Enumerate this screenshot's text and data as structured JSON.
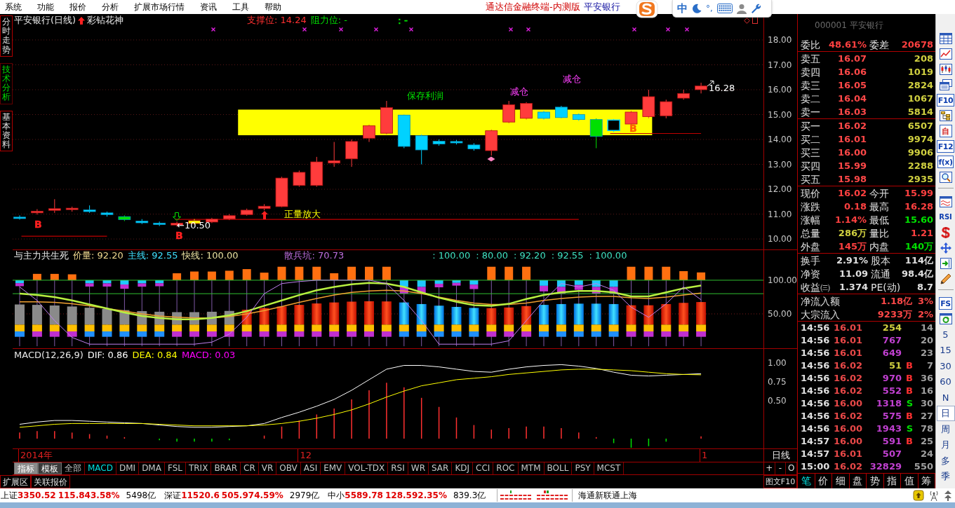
{
  "menu_bar": {
    "items": [
      "系统",
      "功能",
      "报价",
      "分析",
      "扩展市场行情",
      "资讯",
      "工具",
      "帮助"
    ],
    "app_title": "通达信金融终端-内测版",
    "stock_name": "平安银行"
  },
  "ime_bar": {
    "mode": "中",
    "punctuation": "°,"
  },
  "side_tabs": [
    {
      "label": "分时走势",
      "selected": false
    },
    {
      "label": "技术分析",
      "selected": true
    },
    {
      "label": "基本资料",
      "selected": false
    }
  ],
  "price_panel": {
    "title": "平安银行(日线)",
    "formula": "彩钻花神",
    "outputs": [
      {
        "text": "支撑位: 14.24",
        "color": "#ff3030"
      },
      {
        "text": "阻力位: -",
        "color": "#00e000"
      },
      {
        "text": ": -",
        "color": "#00e000"
      }
    ],
    "annotations": [
      {
        "text": "保存利润",
        "color": "#00e000"
      },
      {
        "text": "减仓",
        "color": "#ff40ff"
      },
      {
        "text": "减仓",
        "color": "#ff40ff"
      },
      {
        "text": "正量放大",
        "color": "#ffff00"
      },
      {
        "text": "16.28",
        "color": "#ffffff"
      },
      {
        "text": "←10.50",
        "color": "#ffffff"
      },
      {
        "text": "B",
        "color": "#ff2020"
      },
      {
        "text": "B",
        "color": "#ff2020"
      },
      {
        "text": "B",
        "color": "#ff6000"
      }
    ],
    "axis_labels": [
      "18.00",
      "17.00",
      "16.00",
      "15.00",
      "14.00",
      "13.00",
      "12.00",
      "11.00",
      "10.00"
    ]
  },
  "indicator_panel": {
    "title": "与主力共生死",
    "readings": [
      {
        "text": "价量: 92.20",
        "color": "#f0d890"
      },
      {
        "text": "主线: 92.55",
        "color": "#40e0ff"
      },
      {
        "text": "快线: 100.00",
        "color": "#e8e0a0"
      },
      {
        "text": "散兵坑: 70.73",
        "color": "#c070e0"
      }
    ],
    "extra_readings": [
      {
        "text": ": 100.00",
        "color": "#40e0c0"
      },
      {
        "text": ": 80.00",
        "color": "#40e0c0"
      },
      {
        "text": ": 92.20",
        "color": "#40e0c0"
      },
      {
        "text": ": 92.55",
        "color": "#40e0c0"
      },
      {
        "text": ": 100.00",
        "color": "#40e0c0"
      }
    ],
    "axis_labels": [
      "100.00",
      "50.00"
    ]
  },
  "macd_panel": {
    "title": "MACD(12,26,9)",
    "readings": [
      {
        "text": "DIF: 0.86",
        "color": "#ffffff"
      },
      {
        "text": "DEA: 0.84",
        "color": "#ffff00"
      },
      {
        "text": "MACD: 0.03",
        "color": "#ff00ff"
      }
    ],
    "axis_labels": [
      "1.00",
      "0.75",
      "0.50"
    ]
  },
  "date_labels": [
    "2014年",
    "12",
    "1"
  ],
  "period_label": "日线",
  "indicator_tabs": [
    {
      "label": "指标",
      "kind": "button",
      "selected": true
    },
    {
      "label": "模板",
      "kind": "button",
      "selected": false
    },
    {
      "label": "全部",
      "kind": "tab",
      "selected": false
    },
    {
      "label": "MACD",
      "kind": "tab",
      "selected": true
    },
    {
      "label": "DMI",
      "kind": "tab",
      "selected": false
    },
    {
      "label": "DMA",
      "kind": "tab",
      "selected": false
    },
    {
      "label": "FSL",
      "kind": "tab",
      "selected": false
    },
    {
      "label": "TRIX",
      "kind": "tab",
      "selected": false
    },
    {
      "label": "BRAR",
      "kind": "tab",
      "selected": false
    },
    {
      "label": "CR",
      "kind": "tab",
      "selected": false
    },
    {
      "label": "VR",
      "kind": "tab",
      "selected": false
    },
    {
      "label": "OBV",
      "kind": "tab",
      "selected": false
    },
    {
      "label": "ASI",
      "kind": "tab",
      "selected": false
    },
    {
      "label": "EMV",
      "kind": "tab",
      "selected": false
    },
    {
      "label": "VOL-TDX",
      "kind": "tab",
      "selected": false
    },
    {
      "label": "RSI",
      "kind": "tab",
      "selected": false
    },
    {
      "label": "WR",
      "kind": "tab",
      "selected": false
    },
    {
      "label": "SAR",
      "kind": "tab",
      "selected": false
    },
    {
      "label": "KDJ",
      "kind": "tab",
      "selected": false
    },
    {
      "label": "CCI",
      "kind": "tab",
      "selected": false
    },
    {
      "label": "ROC",
      "kind": "tab",
      "selected": false
    },
    {
      "label": "MTM",
      "kind": "tab",
      "selected": false
    },
    {
      "label": "BOLL",
      "kind": "tab",
      "selected": false
    },
    {
      "label": "PSY",
      "kind": "tab",
      "selected": false
    },
    {
      "label": "MCST",
      "kind": "tab",
      "selected": false
    }
  ],
  "chart_buttons": [
    "+",
    "-",
    "O"
  ],
  "extension_tabs": [
    "扩展区",
    "关联报价"
  ],
  "f10_button": "图文F10",
  "quote_panel": {
    "title": "000001 平安银行",
    "order_ratio": [
      {
        "label": "委比",
        "value": "48.61%",
        "color": "#ff4040"
      },
      {
        "label": "委差",
        "value": "20678",
        "color": "#ff4040"
      }
    ],
    "asks": [
      {
        "label": "卖五",
        "price": "16.07",
        "volume": "208"
      },
      {
        "label": "卖四",
        "price": "16.06",
        "volume": "1019"
      },
      {
        "label": "卖三",
        "price": "16.05",
        "volume": "2824"
      },
      {
        "label": "卖二",
        "price": "16.04",
        "volume": "1067"
      },
      {
        "label": "卖一",
        "price": "16.03",
        "volume": "5814"
      }
    ],
    "bids": [
      {
        "label": "买一",
        "price": "16.02",
        "volume": "6507"
      },
      {
        "label": "买二",
        "price": "16.01",
        "volume": "9974"
      },
      {
        "label": "买三",
        "price": "16.00",
        "volume": "9906"
      },
      {
        "label": "买四",
        "price": "15.99",
        "volume": "2288"
      },
      {
        "label": "买五",
        "price": "15.98",
        "volume": "2935"
      }
    ],
    "stats": [
      {
        "label": "现价",
        "value": "16.02",
        "color": "#ff4040"
      },
      {
        "label": "今开",
        "value": "15.99",
        "color": "#ff4040"
      },
      {
        "label": "涨跌",
        "value": "0.18",
        "color": "#ff4040"
      },
      {
        "label": "最高",
        "value": "16.28",
        "color": "#ff4040"
      },
      {
        "label": "涨幅",
        "value": "1.14%",
        "color": "#ff4040"
      },
      {
        "label": "最低",
        "value": "15.60",
        "color": "#00e000"
      },
      {
        "label": "总量",
        "value": "286万",
        "color": "#d0d040"
      },
      {
        "label": "量比",
        "value": "1.21",
        "color": "#ff4040"
      },
      {
        "label": "外盘",
        "value": "145万",
        "color": "#ff4040"
      },
      {
        "label": "内盘",
        "value": "140万",
        "color": "#00e000"
      }
    ],
    "fundamentals": [
      {
        "label": "换手",
        "value": "2.91%"
      },
      {
        "label": "股本",
        "value": "114亿"
      },
      {
        "label": "净资",
        "value": "11.09"
      },
      {
        "label": "流通",
        "value": "98.4亿"
      },
      {
        "label": "收益㈢",
        "value": "1.374"
      },
      {
        "label": "PE(动)",
        "value": "8.7"
      }
    ],
    "flows": [
      {
        "label": "净流入额",
        "amount": "1.18亿",
        "share": "3%"
      },
      {
        "label": "大宗流入",
        "amount": "9233万",
        "share": "2%"
      }
    ],
    "ticks": [
      {
        "time": "14:56",
        "price": "16.01",
        "volume": "254",
        "color": "#d0d040",
        "count": "14"
      },
      {
        "time": "14:56",
        "price": "16.01",
        "volume": "767",
        "color": "#c040d0",
        "count": "20"
      },
      {
        "time": "14:56",
        "price": "16.01",
        "volume": "649",
        "color": "#c040d0",
        "count": "23"
      },
      {
        "time": "14:56",
        "price": "16.02",
        "volume": "51",
        "color": "#d0d040",
        "flag": {
          "text": "B",
          "color": "#ff3030"
        },
        "count": "7"
      },
      {
        "time": "14:56",
        "price": "16.02",
        "volume": "970",
        "color": "#c040d0",
        "flag": {
          "text": "B",
          "color": "#ff3030"
        },
        "count": "36"
      },
      {
        "time": "14:56",
        "price": "16.02",
        "volume": "552",
        "color": "#c040d0",
        "flag": {
          "text": "B",
          "color": "#ff3030"
        },
        "count": "16"
      },
      {
        "time": "14:56",
        "price": "16.00",
        "volume": "1318",
        "color": "#c040d0",
        "flag": {
          "text": "S",
          "color": "#00e000"
        },
        "count": "30"
      },
      {
        "time": "14:56",
        "price": "16.02",
        "volume": "575",
        "color": "#c040d0",
        "flag": {
          "text": "B",
          "color": "#ff3030"
        },
        "count": "27"
      },
      {
        "time": "14:56",
        "price": "16.00",
        "volume": "1943",
        "color": "#c040d0",
        "flag": {
          "text": "S",
          "color": "#00e000"
        },
        "count": "78"
      },
      {
        "time": "14:57",
        "price": "16.00",
        "volume": "591",
        "color": "#c040d0",
        "flag": {
          "text": "B",
          "color": "#ff3030"
        },
        "count": "25"
      },
      {
        "time": "14:57",
        "price": "16.01",
        "volume": "507",
        "color": "#c040d0",
        "count": "24"
      },
      {
        "time": "15:00",
        "price": "16.02",
        "volume": "32829",
        "color": "#c040d0",
        "count": "550"
      }
    ],
    "detail_tabs": [
      {
        "label": "笔",
        "selected": true
      },
      {
        "label": "价",
        "selected": false
      },
      {
        "label": "细",
        "selected": false
      },
      {
        "label": "盘",
        "selected": false
      },
      {
        "label": "势",
        "selected": false
      },
      {
        "label": "指",
        "selected": false
      },
      {
        "label": "值",
        "selected": false
      },
      {
        "label": "筹",
        "selected": false
      }
    ]
  },
  "toolbar": {
    "tools": [
      {
        "kind": "grid"
      },
      {
        "kind": "trend"
      },
      {
        "kind": "candles"
      },
      {
        "kind": "windows"
      },
      {
        "kind": "badge",
        "label": "F10",
        "color": "#1040b0"
      },
      {
        "kind": "tree"
      },
      {
        "kind": "badge",
        "label": "自",
        "color": "#d02020"
      },
      {
        "kind": "badge",
        "label": "F12",
        "color": "#1040b0"
      },
      {
        "kind": "badge",
        "label": "f(x)",
        "color": "#1040b0"
      },
      {
        "kind": "search"
      },
      {
        "kind": "separator"
      },
      {
        "kind": "wave"
      },
      {
        "kind": "text",
        "label": "RSI"
      },
      {
        "kind": "dollar"
      },
      {
        "kind": "move"
      },
      {
        "kind": "import"
      },
      {
        "kind": "pencil"
      },
      {
        "kind": "separator"
      },
      {
        "kind": "badge",
        "label": "FS",
        "color": "#1040b0"
      },
      {
        "kind": "refresh"
      }
    ],
    "periods": [
      {
        "label": "5",
        "selected": false
      },
      {
        "label": "15",
        "selected": false
      },
      {
        "label": "30",
        "selected": false
      },
      {
        "label": "60",
        "selected": false
      },
      {
        "label": "N",
        "selected": false
      },
      {
        "label": "日",
        "selected": true
      },
      {
        "label": "周",
        "selected": false
      },
      {
        "label": "月",
        "selected": false
      },
      {
        "label": "多",
        "selected": false
      },
      {
        "label": "季",
        "selected": false
      }
    ]
  },
  "status_bar": {
    "indices": [
      {
        "name": "上证",
        "value": "3350.52",
        "change": "115.84",
        "percent": "3.58%",
        "turnover": "5498亿"
      },
      {
        "name": "深证",
        "value": "11520.6",
        "change": "505.97",
        "percent": "4.59%",
        "turnover": "2979亿"
      },
      {
        "name": "中小",
        "value": "5589.78",
        "change": "128.59",
        "percent": "2.35%",
        "turnover": "839.3亿"
      }
    ],
    "server": "海通新联通上海"
  }
}
